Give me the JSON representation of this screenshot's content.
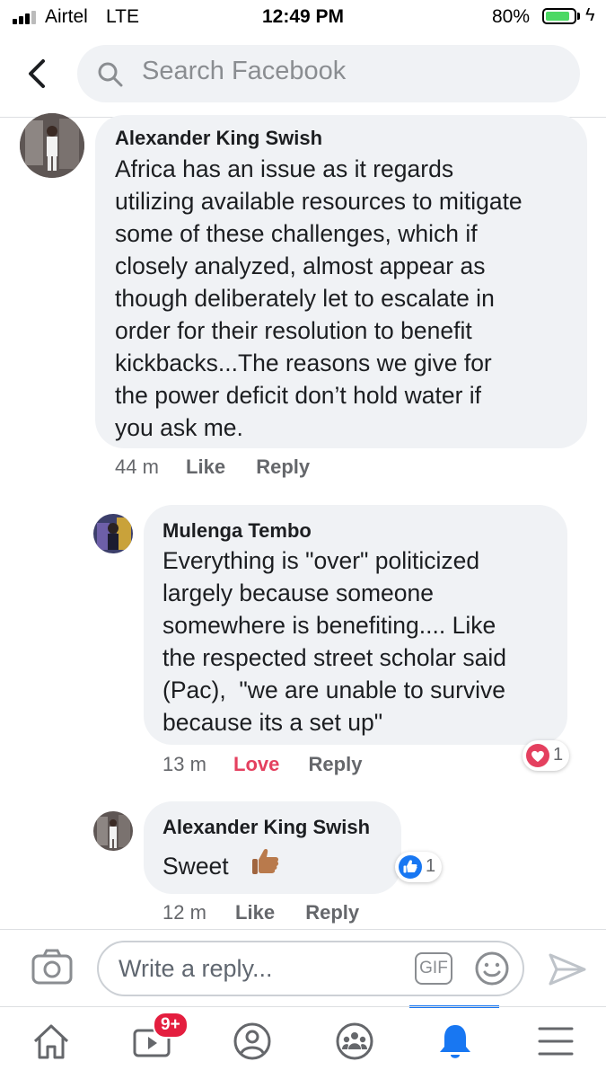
{
  "status_bar": {
    "carrier": "Airtel",
    "network": "LTE",
    "time": "12:49 PM",
    "battery": "80%"
  },
  "search": {
    "placeholder": "Search Facebook"
  },
  "comments": [
    {
      "author": "Alexander King Swish",
      "lines": [
        "Africa has an issue as it regards",
        "utilizing available resources to mitigate",
        "some of these challenges, which if",
        "closely analyzed, almost appear as",
        "though deliberately let to escalate in",
        "order for their resolution to benefit",
        "kickbacks...The reasons we give for",
        "the power deficit don’t hold water if",
        "you ask me."
      ],
      "time": "44 m",
      "like_label": "Like",
      "reply_label": "Reply"
    },
    {
      "author": "Mulenga Tembo",
      "lines": [
        "Everything is \"over\" politicized",
        "largely because someone",
        "somewhere is benefiting.... Like",
        "the respected street scholar said",
        "(Pac),  \"we are unable to survive",
        "because its a set up\""
      ],
      "time": "13 m",
      "like_label": "Love",
      "reply_label": "Reply",
      "reaction": {
        "icon": "heart-icon",
        "count": "1",
        "color": "#e4405f"
      }
    },
    {
      "author": "Alexander King Swish",
      "text": "Sweet",
      "emoji": "thumbs-up-icon",
      "time": "12 m",
      "like_label": "Like",
      "reply_label": "Reply",
      "reaction": {
        "icon": "like-icon",
        "count": "1",
        "color": "#1877f2"
      }
    }
  ],
  "reply_bar": {
    "placeholder": "Write a reply...",
    "gif_label": "GIF"
  },
  "tab_bar": {
    "items": [
      "home-icon",
      "video-icon",
      "profile-icon",
      "groups-icon",
      "notifications-icon",
      "menu-icon"
    ],
    "video_badge": "9+",
    "active": "notifications-icon",
    "accent": "#1877f2"
  }
}
